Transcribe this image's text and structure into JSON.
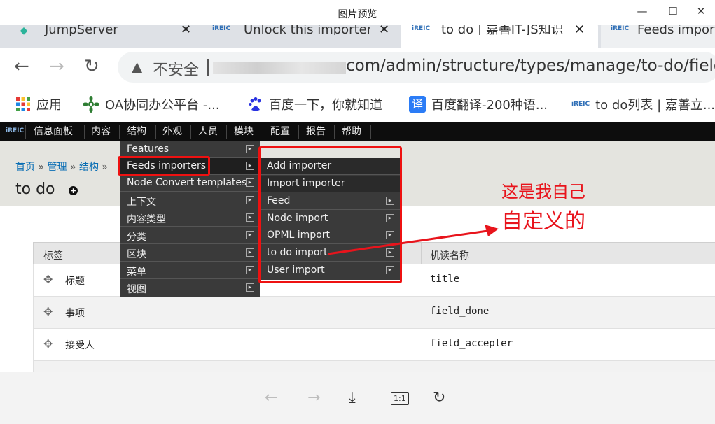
{
  "viewer": {
    "title": "图片预览",
    "minimize": "—",
    "maximize": "☐",
    "close": "✕"
  },
  "tabs": [
    {
      "favicon": "◆",
      "label": "JumpServer",
      "close": "✕"
    },
    {
      "favicon": "iREIC",
      "label": "Unlock this importer",
      "close": "✕"
    },
    {
      "favicon": "iREIC",
      "label": "to do | 嘉善IT-JS知识",
      "close": "✕"
    },
    {
      "favicon": "iREIC",
      "label": "Feeds impor",
      "close": ""
    }
  ],
  "address": {
    "back": "←",
    "forward": "→",
    "reload": "↻",
    "warning": "▲",
    "insecure": "不安全",
    "url": "com/admin/structure/types/manage/to-do/fields"
  },
  "bookmarks": [
    {
      "icon": "apps-grid-icon",
      "label": "应用"
    },
    {
      "icon": "oa-flower-icon",
      "label": "OA协同办公平台 -..."
    },
    {
      "icon": "baidu-paw-icon",
      "label": "百度一下，你就知道"
    },
    {
      "icon": "translate-icon",
      "label": "百度翻译-200种语..."
    },
    {
      "icon": "ireic-icon",
      "label": "to do列表 | 嘉善立..."
    }
  ],
  "topnav": {
    "logo": "iREIC",
    "items": [
      "信息面板",
      "内容",
      "结构",
      "外观",
      "人员",
      "模块",
      "配置",
      "报告",
      "帮助"
    ]
  },
  "breadcrumb": {
    "items": [
      "首页",
      "管理",
      "结构"
    ],
    "sep": "»"
  },
  "page_title": "to do",
  "plus": "+",
  "menu_structure": [
    {
      "label": "Features",
      "arrow": "▸"
    },
    {
      "label": "Feeds importers",
      "arrow": "▸"
    },
    {
      "label": "Node Convert templates",
      "arrow": "▸"
    },
    {
      "label": "上下文",
      "arrow": "▸"
    },
    {
      "label": "内容类型",
      "arrow": "▸"
    },
    {
      "label": "分类",
      "arrow": "▸"
    },
    {
      "label": "区块",
      "arrow": "▸"
    },
    {
      "label": "菜单",
      "arrow": "▸"
    },
    {
      "label": "视图",
      "arrow": "▸"
    }
  ],
  "menu_feeds": [
    {
      "label": "Add importer",
      "arrow": ""
    },
    {
      "label": "Import importer",
      "arrow": ""
    },
    {
      "label": "Feed",
      "arrow": "▸"
    },
    {
      "label": "Node import",
      "arrow": "▸"
    },
    {
      "label": "OPML import",
      "arrow": "▸"
    },
    {
      "label": "to do import",
      "arrow": "▸"
    },
    {
      "label": "User import",
      "arrow": "▸"
    }
  ],
  "table": {
    "col_label": "标签",
    "col_machine": "机读名称",
    "rows": [
      {
        "label": "标题",
        "machine": "title"
      },
      {
        "label": "事项",
        "machine": "field_done"
      },
      {
        "label": "接受人",
        "machine": "field_accepter"
      }
    ]
  },
  "annotation": {
    "line1": "这是我自己",
    "line2": "自定义的",
    "color": "#e8141c"
  },
  "viewer_toolbar": {
    "prev": "←",
    "next": "→",
    "download": "⤓",
    "actual_size": "1:1",
    "rotate": "↻"
  }
}
